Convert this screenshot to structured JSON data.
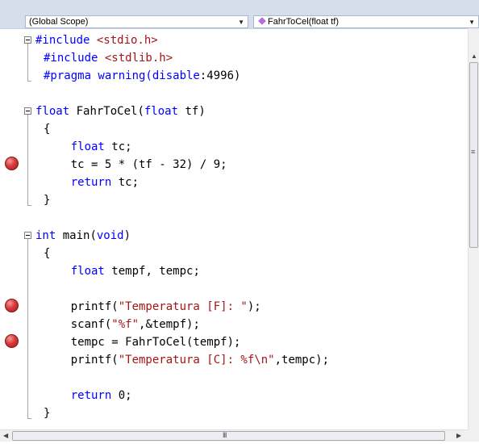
{
  "navigation_bar": {
    "scope_combo": {
      "value": "(Global Scope)"
    },
    "member_combo": {
      "value": "FahrToCel(float tf)"
    }
  },
  "editor": {
    "breakpoint_color": "#d63a3a",
    "lines": [
      [
        {
          "t": "#include ",
          "c": "kw"
        },
        {
          "t": "<stdio.h>",
          "c": "str"
        }
      ],
      [
        {
          "t": "#include ",
          "c": "kw"
        },
        {
          "t": "<stdlib.h>",
          "c": "str"
        }
      ],
      [
        {
          "t": "#pragma warning(",
          "c": "kw"
        },
        {
          "t": "disable",
          "c": "kw"
        },
        {
          "t": ":4996)",
          "c": ""
        }
      ],
      [],
      [
        {
          "t": "float",
          "c": "kw"
        },
        {
          "t": " FahrToCel(",
          "c": ""
        },
        {
          "t": "float",
          "c": "kw"
        },
        {
          "t": " tf)",
          "c": ""
        }
      ],
      [
        {
          "t": "{",
          "c": ""
        }
      ],
      [
        {
          "t": "    ",
          "c": ""
        },
        {
          "t": "float",
          "c": "kw"
        },
        {
          "t": " tc;",
          "c": ""
        }
      ],
      [
        {
          "t": "    tc = 5 * (tf - 32) / 9;",
          "c": ""
        }
      ],
      [
        {
          "t": "    ",
          "c": ""
        },
        {
          "t": "return",
          "c": "kw"
        },
        {
          "t": " tc;",
          "c": ""
        }
      ],
      [
        {
          "t": "}",
          "c": ""
        }
      ],
      [],
      [
        {
          "t": "int",
          "c": "kw"
        },
        {
          "t": " main(",
          "c": ""
        },
        {
          "t": "void",
          "c": "kw"
        },
        {
          "t": ")",
          "c": ""
        }
      ],
      [
        {
          "t": "{",
          "c": ""
        }
      ],
      [
        {
          "t": "    ",
          "c": ""
        },
        {
          "t": "float",
          "c": "kw"
        },
        {
          "t": " tempf, tempc;",
          "c": ""
        }
      ],
      [],
      [
        {
          "t": "    printf(",
          "c": ""
        },
        {
          "t": "\"Temperatura [F]: \"",
          "c": "str"
        },
        {
          "t": ");",
          "c": ""
        }
      ],
      [
        {
          "t": "    scanf(",
          "c": ""
        },
        {
          "t": "\"%f\"",
          "c": "str"
        },
        {
          "t": ",&tempf);",
          "c": ""
        }
      ],
      [
        {
          "t": "    tempc = FahrToCel(tempf);",
          "c": ""
        }
      ],
      [
        {
          "t": "    printf(",
          "c": ""
        },
        {
          "t": "\"Temperatura [C]: %f\\n\"",
          "c": "str"
        },
        {
          "t": ",tempc);",
          "c": ""
        }
      ],
      [],
      [
        {
          "t": "    ",
          "c": ""
        },
        {
          "t": "return",
          "c": "kw"
        },
        {
          "t": " 0;",
          "c": ""
        }
      ],
      [
        {
          "t": "}",
          "c": ""
        }
      ]
    ],
    "breakpoint_lines": [
      7,
      15,
      17
    ],
    "collapse_lines": [
      0,
      4,
      11
    ]
  },
  "scrollbars": {
    "horizontal_grip": "III"
  }
}
